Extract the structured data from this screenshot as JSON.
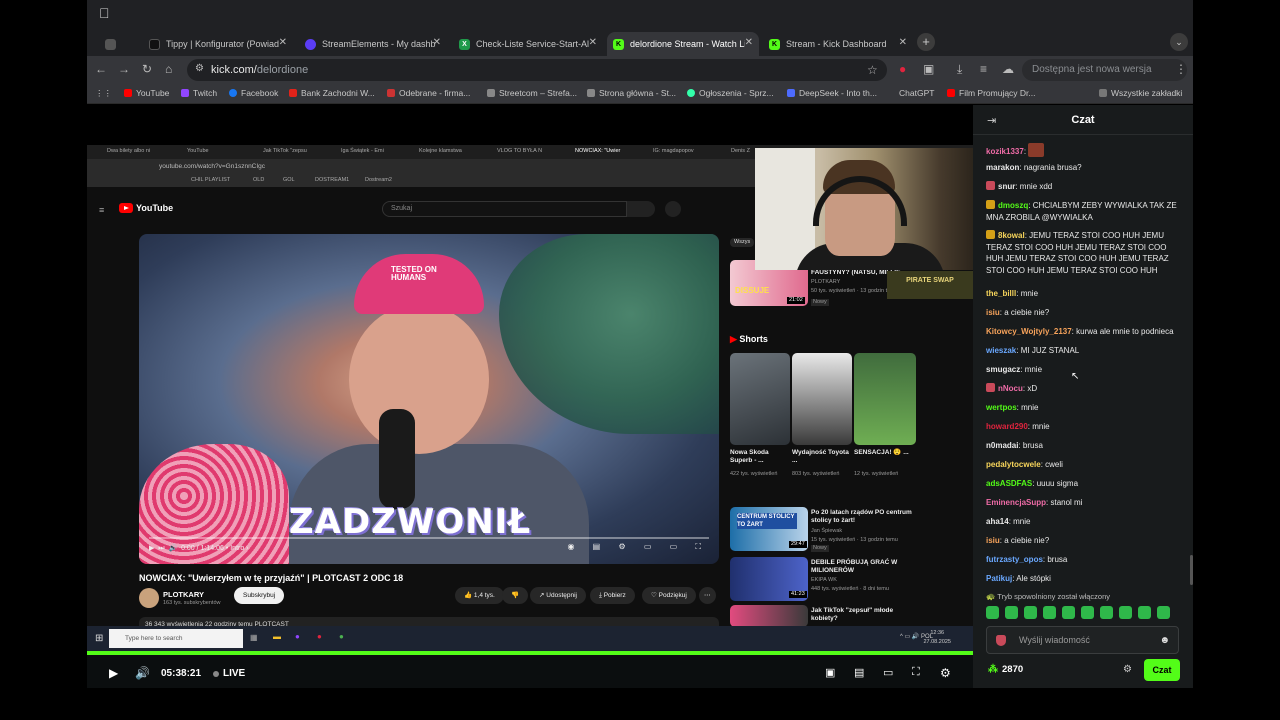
{
  "browser": {
    "tabs": [
      {
        "title": "Tippy | Konfigurator (Powiad",
        "color": "#111111",
        "active": false
      },
      {
        "title": "StreamElements - My dashb",
        "color": "#5b3df5",
        "active": false
      },
      {
        "title": "Check-Liste Service-Start-Al",
        "color": "#1f9a4a",
        "active": false
      },
      {
        "title": "delordione Stream - Watch Li",
        "color": "#53fc18",
        "active": true
      },
      {
        "title": "Stream - Kick Dashboard",
        "color": "#53fc18",
        "active": false
      }
    ],
    "new_tab": "+",
    "url_host": "kick.com/",
    "url_path": "delordione",
    "update_notice": "Dostępna jest nowa wersja Chrome",
    "bookmarks": [
      {
        "label": "YouTube",
        "color": "#ff0000"
      },
      {
        "label": "Twitch",
        "color": "#9146ff"
      },
      {
        "label": "Facebook",
        "color": "#1877f2"
      },
      {
        "label": "Bank Zachodni W...",
        "color": "#e2231a"
      },
      {
        "label": "Odebrane - firma...",
        "color": "#c33"
      },
      {
        "label": "Streetcom – Strefa...",
        "color": "#888"
      },
      {
        "label": "Strona główna - St...",
        "color": "#888"
      },
      {
        "label": "Ogłoszenia - Sprz...",
        "color": "#3fa"
      },
      {
        "label": "DeepSeek - Into th...",
        "color": "#4d6bfe"
      },
      {
        "label": "ChatGPT",
        "color": "#555"
      },
      {
        "label": "Film Promujący Dr...",
        "color": "#ff0000"
      },
      {
        "label": "Wszystkie zakładki",
        "color": "#777"
      }
    ]
  },
  "capture": {
    "inner_tabs": [
      "Dwa bilety albo ni",
      "YouTube",
      "Jak TikTok \"zepsu",
      "Iga Świątek - Emi",
      "Kolejne klamstwa",
      "VLOG TO BYŁA N",
      "NOWCIAX: \"Uwier",
      "IG: magdapopov",
      "Denis Z"
    ],
    "inner_url": "youtube.com/watch?v=Gn1sznnCIgc",
    "inner_bookmarks": [
      "CHIL PLAYLIST",
      "OLD",
      "GOL",
      "DOSTREAM1",
      "Dostream2"
    ],
    "yt_search_placeholder": "Szukaj",
    "yt_logo": "YouTube",
    "hat_text": "TESTED ON HUMANS",
    "caption": "ZADZWONIŁ",
    "time": "0:00 / 1:14:06 • Intro ›",
    "video_title": "NOWCIAX: \"Uwierzyłem w tę przyjaźń\" | PLOTCAST 2 ODC 18",
    "channel": "PLOTKARY",
    "channel_subs": "163 tys. subskrybentów",
    "subscribe": "Subskrybuj",
    "likes": "1,4 tys.",
    "share": "Udostępnij",
    "download": "Pobierz",
    "thanks": "Podziękuj",
    "desc": "36 343 wyświetlenia  22 godziny temu  PLOTCAST",
    "shorts_heading": "Shorts",
    "top_right_chip": "Wszys",
    "rec_top": {
      "title": "FAUSTYNY? (NATSU, MILLIE",
      "channel": "PLOTKARY",
      "meta": "50 tys. wyświetleń · 13 godzin temu",
      "badge": "Nowy",
      "thumb_text": "DISSUJE",
      "duration": "21:02"
    },
    "shorts": [
      {
        "title": "Nowa Skoda Superb - ...",
        "meta": "422 tys. wyświetleń"
      },
      {
        "title": "Wydajność Toyota ...",
        "meta": "803 tys. wyświetleń"
      },
      {
        "title": "SENSACJA! 😲 ...",
        "meta": "12 tys. wyświetleń"
      }
    ],
    "recs": [
      {
        "title": "Po 20 latach rządów PO centrum stolicy to żart!",
        "channel": "Jan Śpiewak",
        "meta": "15 tys. wyświetleń · 13 godzin temu",
        "badge": "Nowy",
        "thumb": "CENTRUM STOLICY TO ŻART",
        "duration": "29:47"
      },
      {
        "title": "DEBILE PRÓBUJĄ GRAĆ W MILIONERÓW",
        "channel": "EKIPA WK",
        "meta": "448 tys. wyświetleń · 8 dni temu",
        "thumb": "",
        "duration": "41:23"
      },
      {
        "title": "Jak TikTok \"zepsuł\" młode kobiety?",
        "channel": "",
        "meta": "",
        "thumb": "",
        "duration": ""
      }
    ],
    "taskbar_search": "Type here to search",
    "tray": "POL",
    "clock_time": "12:36",
    "clock_date": "27.08.2025",
    "pirate_swap": "PIRATE SWAP"
  },
  "player": {
    "time": "05:38:21",
    "live": "LIVE",
    "progress": 1.0
  },
  "chat": {
    "title": "Czat",
    "messages": [
      {
        "user": "kozik1337",
        "color": "#ef6ca7",
        "text": "",
        "emote": true,
        "badge": ""
      },
      {
        "user": "marakon",
        "color": "#e9e9e9",
        "text": "nagrania brusa?",
        "badge": ""
      },
      {
        "user": "snur",
        "color": "#e9e9e9",
        "text": "mnie xdd",
        "badge": "#c94a5a"
      },
      {
        "user": "dmoszq",
        "color": "#53fc18",
        "text": "CHCIALBYM ZEBY WYWIALKA TAK ZE MNA ZROBILA @WYWIALKA",
        "badge": "#d4a017"
      },
      {
        "user": "8kowal",
        "color": "#f7d55b",
        "text": "JEMU TERAZ STOI COO HUH JEMU TERAZ STOI COO HUH JEMU TERAZ STOI COO HUH JEMU TERAZ STOI COO HUH JEMU TERAZ STOI COO HUH JEMU TERAZ STOI COO HUH",
        "badge": "#d4a017"
      },
      {
        "user": "the_billl",
        "color": "#f7d55b",
        "text": "mnie",
        "badge": ""
      },
      {
        "user": "isiu",
        "color": "#f7a35b",
        "text": "a ciebie nie?",
        "badge": ""
      },
      {
        "user": "Kitowcy_Wojtyly_2137",
        "color": "#f7a35b",
        "text": "kurwa ale mnie to podnieca",
        "badge": ""
      },
      {
        "user": "wieszak",
        "color": "#6aa8ff",
        "text": "MI JUZ STANAL",
        "badge": ""
      },
      {
        "user": "smugacz",
        "color": "#e9e9e9",
        "text": "mnie",
        "badge": ""
      },
      {
        "user": "nNocu",
        "color": "#ef6ca7",
        "text": "xD",
        "badge": "#c94a5a"
      },
      {
        "user": "wertpos",
        "color": "#53fc18",
        "text": "mnie",
        "badge": ""
      },
      {
        "user": "howard290",
        "color": "#e0243e",
        "text": "mnie",
        "badge": ""
      },
      {
        "user": "n0madai",
        "color": "#e9e9e9",
        "text": "brusa",
        "badge": ""
      },
      {
        "user": "pedalytocwele",
        "color": "#f7d55b",
        "text": "cweli",
        "badge": ""
      },
      {
        "user": "adsASDFAS",
        "color": "#53fc18",
        "text": "uuuu sigma",
        "badge": ""
      },
      {
        "user": "EminencjaSupp",
        "color": "#ef6ca7",
        "text": "stanol mi",
        "badge": ""
      },
      {
        "user": "aha14",
        "color": "#e9e9e9",
        "text": "mnie",
        "badge": ""
      },
      {
        "user": "isiu",
        "color": "#f7a35b",
        "text": "a ciebie nie?",
        "badge": ""
      },
      {
        "user": "futrzasty_opos",
        "color": "#6aa8ff",
        "text": "brusa",
        "badge": ""
      },
      {
        "user": "Patikuj",
        "color": "#6aa8ff",
        "text": "Ale stópki",
        "badge": ""
      }
    ],
    "slow_mode": "Tryb spowolniony został włączony",
    "input_placeholder": "Wyślij wiadomość",
    "points": "2870",
    "send": "Czat",
    "accent": "#53fc18"
  }
}
